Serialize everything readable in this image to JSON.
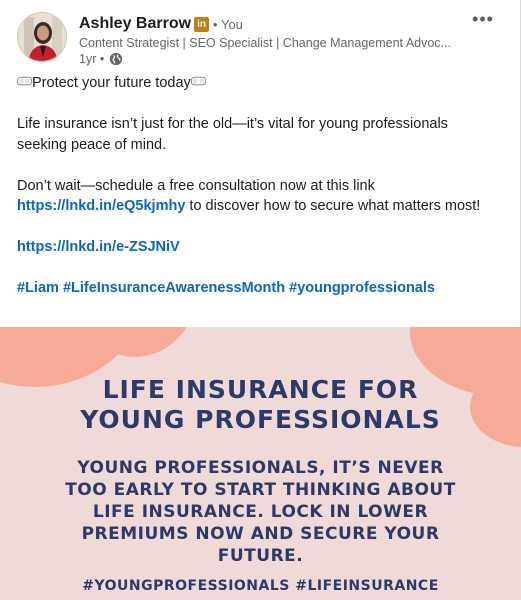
{
  "author": {
    "name": "Ashley Barrow",
    "badge": "in",
    "you_label": "• You",
    "headline": "Content Strategist | SEO Specialist | Change Management Advoc...",
    "time": "1yr •"
  },
  "icons": {
    "menu": "more-horizontal-icon",
    "globe": "globe-icon",
    "goggles": "goggles-icon"
  },
  "post": {
    "line1": "Protect your future today",
    "para2": "Life insurance isn’t just for the old—it’s vital for young professionals seeking peace of mind.",
    "para3_prefix": "Don’t wait—schedule a free consultation now at this link ",
    "link1": "https://lnkd.in/eQ5kjmhy",
    "para3_suffix": " to discover how to secure what matters most!",
    "link2": "https://lnkd.in/e-ZSJNiV",
    "hashtags": [
      "#Liam",
      "#LifeInsuranceAwarenessMonth",
      "#youngprofessionals"
    ]
  },
  "image": {
    "title_line1": "LIFE INSURANCE FOR",
    "title_line2": "YOUNG PROFESSIONALS",
    "sub_line1": "YOUNG PROFESSIONALS, IT’S NEVER",
    "sub_line2": "TOO EARLY TO START THINKING ABOUT",
    "sub_line3": "LIFE INSURANCE. LOCK IN LOWER",
    "sub_line4": "PREMIUMS NOW AND SECURE YOUR",
    "sub_line5": "FUTURE.",
    "tags": "#YOUNGPROFESSIONALS #LIFEINSURANCE"
  },
  "colors": {
    "link": "#0a66c2",
    "image_bg": "#f0dad7",
    "image_text": "#2b3a6a",
    "blob": "#f6aa97",
    "badge": "#c37d16"
  }
}
